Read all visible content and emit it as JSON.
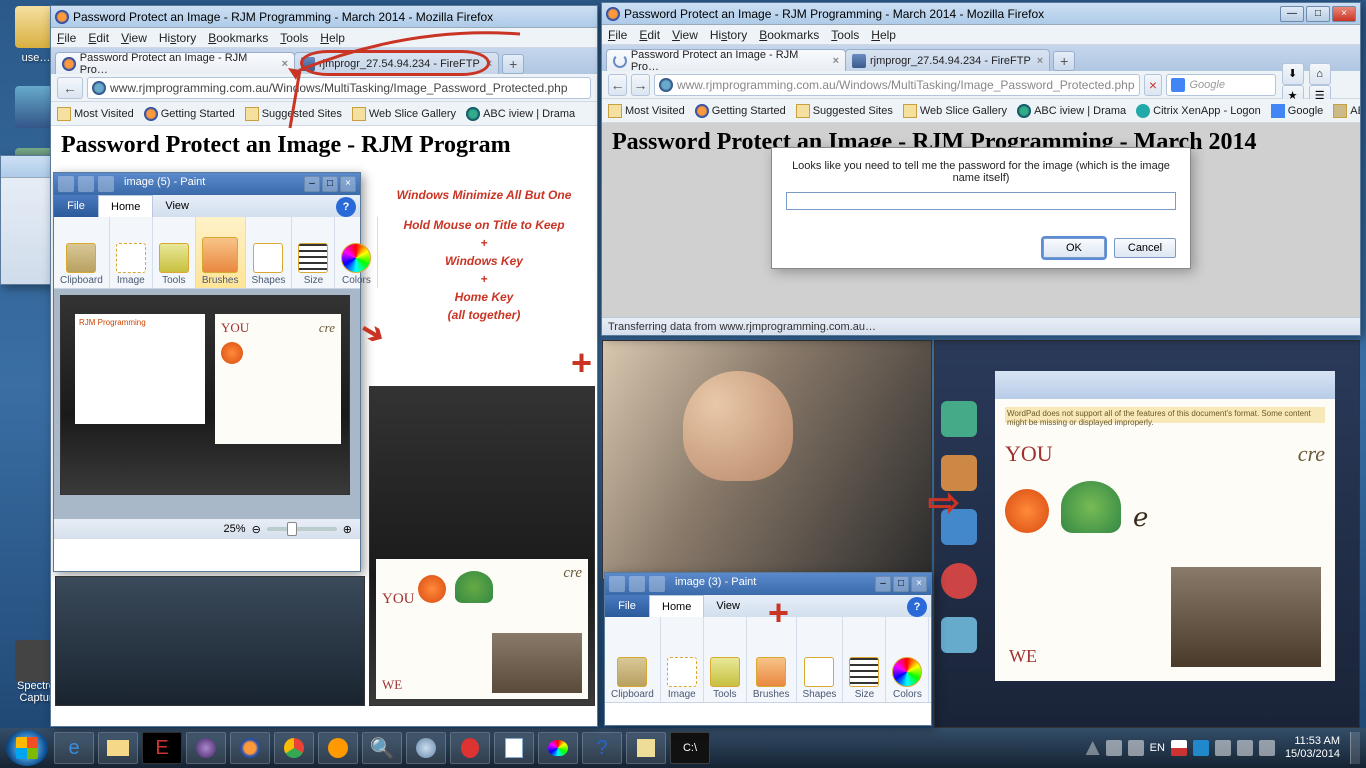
{
  "desktop": {
    "icons": [
      "use…",
      "",
      "",
      "",
      "",
      "Spectro",
      "Captur"
    ]
  },
  "leftWindow": {
    "title": "Password Protect an Image - RJM Programming - March 2014 - Mozilla Firefox",
    "menu": [
      "File",
      "Edit",
      "View",
      "History",
      "Bookmarks",
      "Tools",
      "Help"
    ],
    "tabs": [
      {
        "label": "Password Protect an Image - RJM Pro…",
        "active": true
      },
      {
        "label": "rjmprogr_27.54.94.234 - FireFTP",
        "active": false
      }
    ],
    "url": "www.rjmprogramming.com.au/Windows/MultiTasking/Image_Password_Protected.php",
    "bookmarks": [
      "Most Visited",
      "Getting Started",
      "Suggested Sites",
      "Web Slice Gallery",
      "ABC iview | Drama"
    ],
    "pageTitle": "Password Protect an Image - RJM Program",
    "instr": {
      "l1": "Windows Minimize All But One",
      "l2": "Hold Mouse on Title to Keep",
      "l3": "+",
      "l4": "Windows Key",
      "l5": "+",
      "l6": "Home Key",
      "l7": "(all together)"
    }
  },
  "rightWindow": {
    "title": "Password Protect an Image - RJM Programming - March 2014 - Mozilla Firefox",
    "menu": [
      "File",
      "Edit",
      "View",
      "History",
      "Bookmarks",
      "Tools",
      "Help"
    ],
    "tabs": [
      {
        "label": "Password Protect an Image - RJM Pro…",
        "active": true
      },
      {
        "label": "rjmprogr_27.54.94.234 - FireFTP",
        "active": false
      }
    ],
    "url": "www.rjmprogramming.com.au/Windows/MultiTasking/Image_Password_Protected.php",
    "searchPlaceholder": "Google",
    "bookmarks": [
      "Most Visited",
      "Getting Started",
      "Suggested Sites",
      "Web Slice Gallery",
      "ABC iview | Drama",
      "Citrix XenApp - Logon",
      "Google",
      "ABC Radio National (A…"
    ],
    "pageTitle": "Password Protect an Image - RJM Programming - March 2014",
    "dialog": {
      "msg": "Looks like you need to tell me the password for the image (which is the image name itself)",
      "ok": "OK",
      "cancel": "Cancel"
    },
    "status": "Transferring data from www.rjmprogramming.com.au…"
  },
  "paintLeft": {
    "qatTitle": "image (5) - Paint",
    "tabs": {
      "file": "File",
      "home": "Home",
      "view": "View"
    },
    "groups": [
      "Clipboard",
      "Image",
      "Tools",
      "Brushes",
      "Shapes",
      "Size",
      "Colors"
    ],
    "zoom": "25%"
  },
  "paintRight": {
    "qatTitle": "image (3) - Paint",
    "tabs": {
      "file": "File",
      "home": "Home",
      "view": "View"
    },
    "groups": [
      "Clipboard",
      "Image",
      "Tools",
      "Brushes",
      "Shapes",
      "Size",
      "Colors"
    ]
  },
  "photoText": {
    "you": "YOU",
    "cre": "cre",
    "we": "WE"
  },
  "tray": {
    "lang": "EN",
    "time": "11:53 AM",
    "date": "15/03/2014"
  }
}
